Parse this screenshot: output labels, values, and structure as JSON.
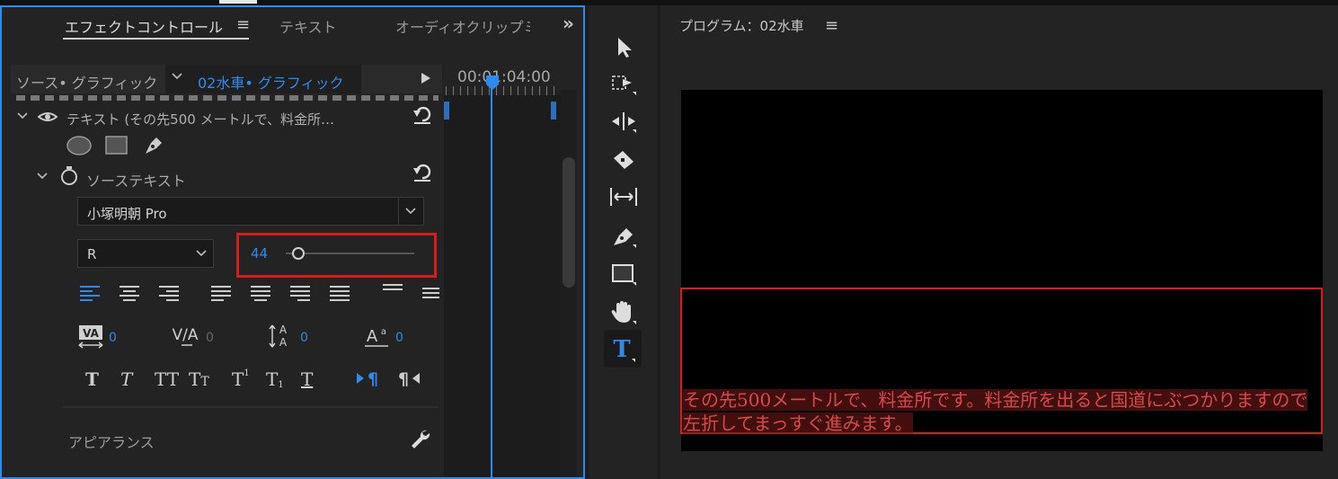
{
  "effect_panel": {
    "tabs": [
      {
        "label": "エフェクトコントロール"
      },
      {
        "label": "テキスト"
      },
      {
        "label": "オーディオクリップミ"
      }
    ],
    "menu_icon": "≡",
    "overflow_icon": "»",
    "source_tab": "ソース• グラフィック",
    "active_tab": "02水車• グラフィック",
    "timecode": "00:01:04:00",
    "text_layer_label": "テキスト (その先500 メートルで、料金所…",
    "source_text_label": "ソーステキスト",
    "font_name": "小塚明朝 Pro",
    "font_style": "R",
    "font_size": "44",
    "tracking": "0",
    "kerning": "0",
    "leading": "0",
    "baseline": "0",
    "appearance_label": "アピアランス"
  },
  "program_panel": {
    "title": "プログラム：02水車",
    "menu_icon": "≡",
    "subtitle_line1": "その先500メートルで、料金所です。料金所を出ると国道にぶつかりますので",
    "subtitle_line2": "左折してまっすぐ進みます。"
  },
  "colors": {
    "accent": "#2d8ceb",
    "highlight_red": "#d81b1b",
    "panel_bg": "#232323"
  }
}
